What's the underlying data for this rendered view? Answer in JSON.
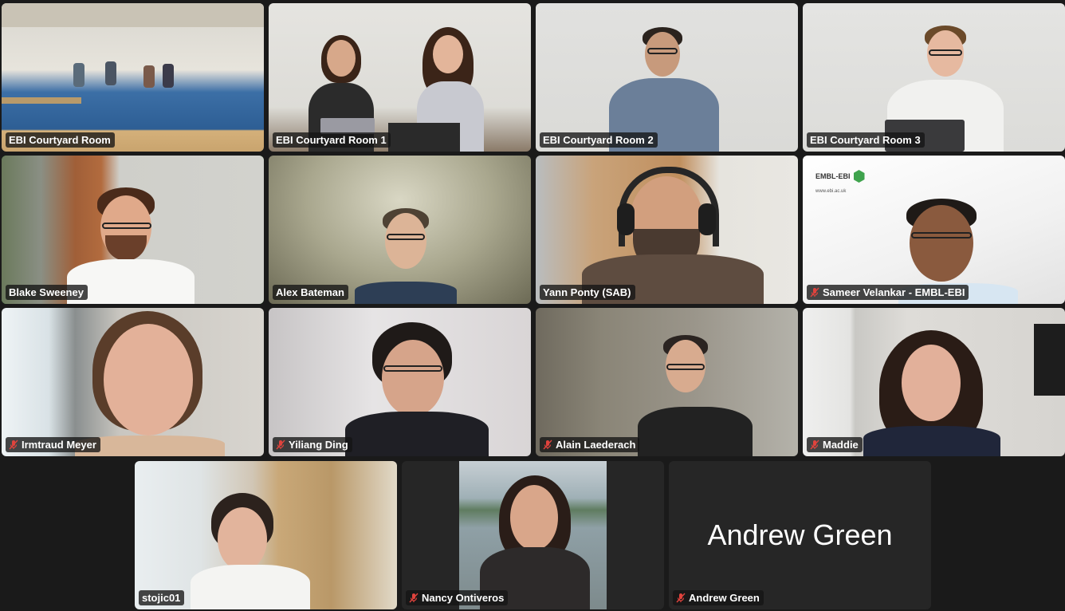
{
  "meeting": {
    "participants": [
      {
        "name": "EBI Courtyard Room",
        "muted": false
      },
      {
        "name": "EBI Courtyard Room 1",
        "muted": false
      },
      {
        "name": "EBI Courtyard Room 2",
        "muted": false
      },
      {
        "name": "EBI Courtyard Room 3",
        "muted": false
      },
      {
        "name": "Blake Sweeney",
        "muted": false,
        "active_speaker": true
      },
      {
        "name": "Alex Bateman",
        "muted": false
      },
      {
        "name": "Yann Ponty (SAB)",
        "muted": false
      },
      {
        "name": "Sameer Velankar - EMBL-EBI",
        "muted": true
      },
      {
        "name": "Irmtraud Meyer",
        "muted": true
      },
      {
        "name": "Yiliang Ding",
        "muted": true
      },
      {
        "name": "Alain Laederach",
        "muted": true
      },
      {
        "name": "Maddie",
        "muted": true
      },
      {
        "name": "stojic01",
        "muted": false
      },
      {
        "name": "Nancy Ontiveros",
        "muted": true
      },
      {
        "name": "Andrew Green",
        "muted": true,
        "video_off": true
      }
    ],
    "video_off_display_name": "Andrew Green",
    "embl_logo_text": "EMBL-EBI",
    "embl_logo_url": "www.ebi.ac.uk"
  },
  "colors": {
    "background": "#1a1a1a",
    "active_speaker_border": "#3ec246",
    "muted_icon": "#e0433d"
  }
}
